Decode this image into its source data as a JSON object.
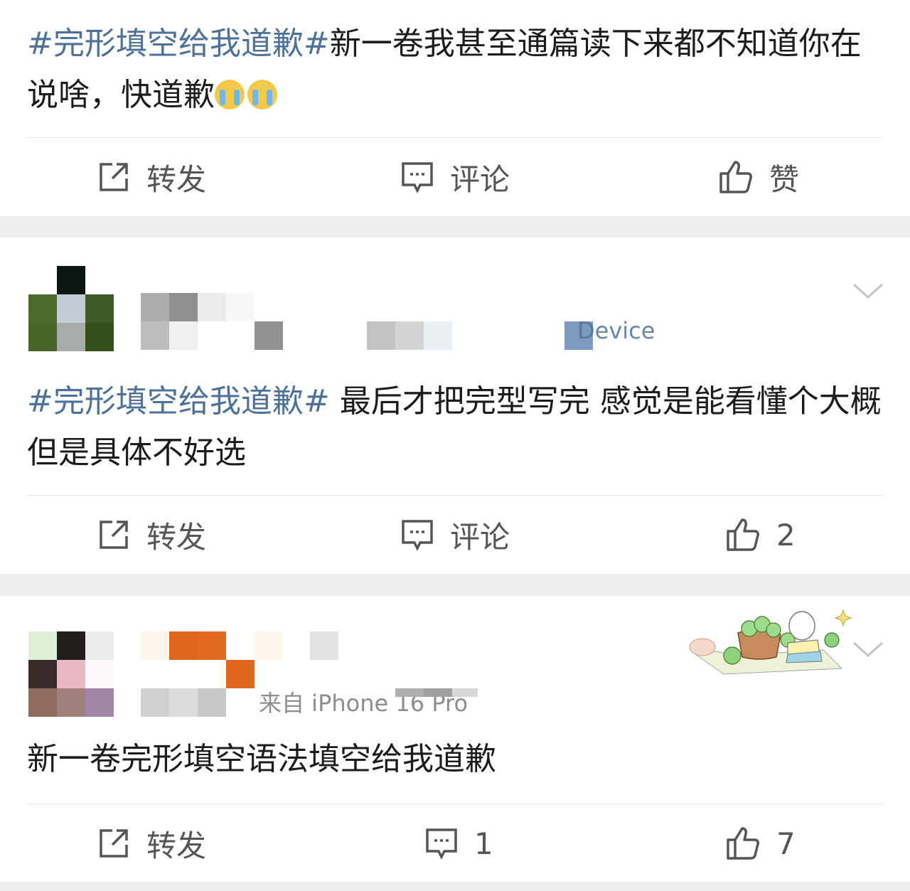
{
  "posts": [
    {
      "hashtag": "#完形填空给我道歉#",
      "body": "新一卷我甚至通篇读下来都不知道你在说啥，快道歉",
      "emojis": [
        "crying-face",
        "crying-face"
      ],
      "repost_label": "转发",
      "comment_label": "评论",
      "like_label": "赞"
    },
    {
      "source_fragment": "Device",
      "hashtag": "#完形填空给我道歉#",
      "body": " 最后才把完型写完  感觉是能看懂个大概但是具体不好选",
      "repost_label": "转发",
      "comment_label": "评论",
      "like_count": "2"
    },
    {
      "source_fragment": "来自 iPhone 16 Pro",
      "body": "新一卷完形填空语法填空给我道歉",
      "repost_label": "转发",
      "comment_count": "1",
      "like_count": "7"
    }
  ],
  "colors": {
    "hashtag": "#4d7199",
    "text": "#1c1c1c",
    "action": "#555555",
    "separator": "#efefef"
  },
  "icons": [
    "repost-icon",
    "comment-icon",
    "like-icon",
    "chevron-down-icon",
    "crying-face-emoji"
  ]
}
